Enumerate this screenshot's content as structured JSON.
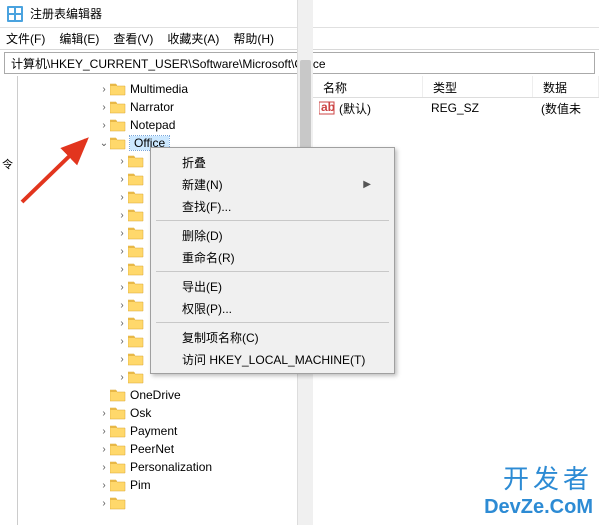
{
  "title": "注册表编辑器",
  "menubar": [
    "文件(F)",
    "编辑(E)",
    "查看(V)",
    "收藏夹(A)",
    "帮助(H)"
  ],
  "address": "计算机\\HKEY_CURRENT_USER\\Software\\Microsoft\\Office",
  "leftcol_char": "令",
  "tree": [
    {
      "indent": 80,
      "exp": ">",
      "label": "Multimedia"
    },
    {
      "indent": 80,
      "exp": ">",
      "label": "Narrator"
    },
    {
      "indent": 80,
      "exp": ">",
      "label": "Notepad"
    },
    {
      "indent": 80,
      "exp": "v",
      "label": "Office",
      "selected": true
    },
    {
      "indent": 98,
      "exp": ">",
      "label": ""
    },
    {
      "indent": 98,
      "exp": ">",
      "label": ""
    },
    {
      "indent": 98,
      "exp": ">",
      "label": ""
    },
    {
      "indent": 98,
      "exp": ">",
      "label": ""
    },
    {
      "indent": 98,
      "exp": ">",
      "label": ""
    },
    {
      "indent": 98,
      "exp": ">",
      "label": ""
    },
    {
      "indent": 98,
      "exp": ">",
      "label": ""
    },
    {
      "indent": 98,
      "exp": ">",
      "label": ""
    },
    {
      "indent": 98,
      "exp": ">",
      "label": ""
    },
    {
      "indent": 98,
      "exp": ">",
      "label": ""
    },
    {
      "indent": 98,
      "exp": ">",
      "label": ""
    },
    {
      "indent": 98,
      "exp": ">",
      "label": ""
    },
    {
      "indent": 98,
      "exp": ">",
      "label": ""
    },
    {
      "indent": 80,
      "exp": "",
      "label": "OneDrive"
    },
    {
      "indent": 80,
      "exp": ">",
      "label": "Osk"
    },
    {
      "indent": 80,
      "exp": ">",
      "label": "Payment"
    },
    {
      "indent": 80,
      "exp": ">",
      "label": "PeerNet"
    },
    {
      "indent": 80,
      "exp": ">",
      "label": "Personalization"
    },
    {
      "indent": 80,
      "exp": ">",
      "label": "Pim"
    },
    {
      "indent": 80,
      "exp": ">",
      "label": ""
    }
  ],
  "columns": {
    "name": "名称",
    "type": "类型",
    "data": "数据"
  },
  "list_rows": [
    {
      "name": "(默认)",
      "type": "REG_SZ",
      "data": "(数值未"
    }
  ],
  "context_menu": [
    {
      "label": "折叠"
    },
    {
      "label": "新建(N)",
      "submenu": true
    },
    {
      "label": "查找(F)..."
    },
    {
      "sep": true
    },
    {
      "label": "删除(D)",
      "highlight": true
    },
    {
      "label": "重命名(R)"
    },
    {
      "sep": true
    },
    {
      "label": "导出(E)"
    },
    {
      "label": "权限(P)..."
    },
    {
      "sep": true
    },
    {
      "label": "复制项名称(C)"
    },
    {
      "label": "访问 HKEY_LOCAL_MACHINE(T)"
    }
  ],
  "watermark": {
    "line1": "开发者",
    "line2": "DevZe.CoM"
  }
}
